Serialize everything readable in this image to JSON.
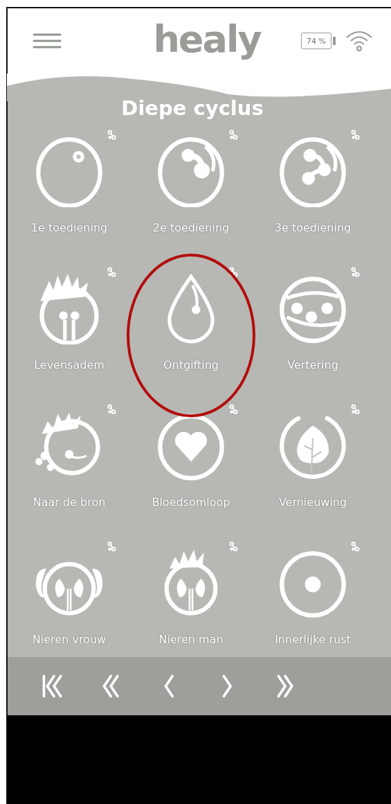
{
  "header": {
    "logo": "healy",
    "battery": "74 %"
  },
  "title": "Diepe cyclus",
  "programs": [
    {
      "label": "1e toediening",
      "kind": "one",
      "circled": false
    },
    {
      "label": "2e toediening",
      "kind": "two",
      "circled": false
    },
    {
      "label": "3e toediening",
      "kind": "three",
      "circled": false
    },
    {
      "label": "Levensadem",
      "kind": "breath",
      "circled": false
    },
    {
      "label": "Ontgifting",
      "kind": "drop",
      "circled": true
    },
    {
      "label": "Vertering",
      "kind": "digest",
      "circled": false
    },
    {
      "label": "Naar de bron",
      "kind": "source",
      "circled": false
    },
    {
      "label": "Bloedsomloop",
      "kind": "heart",
      "circled": false
    },
    {
      "label": "Vernieuwing",
      "kind": "leaf",
      "circled": false
    },
    {
      "label": "Nieren vrouw",
      "kind": "kidneysf",
      "circled": false
    },
    {
      "label": "Nieren man",
      "kind": "kidneysm",
      "circled": false
    },
    {
      "label": "Innerlijke rust",
      "kind": "dot",
      "circled": false
    }
  ],
  "pager": [
    {
      "kind": "first"
    },
    {
      "kind": "fastback"
    },
    {
      "kind": "back"
    },
    {
      "kind": "forward"
    },
    {
      "kind": "fastforward"
    }
  ]
}
